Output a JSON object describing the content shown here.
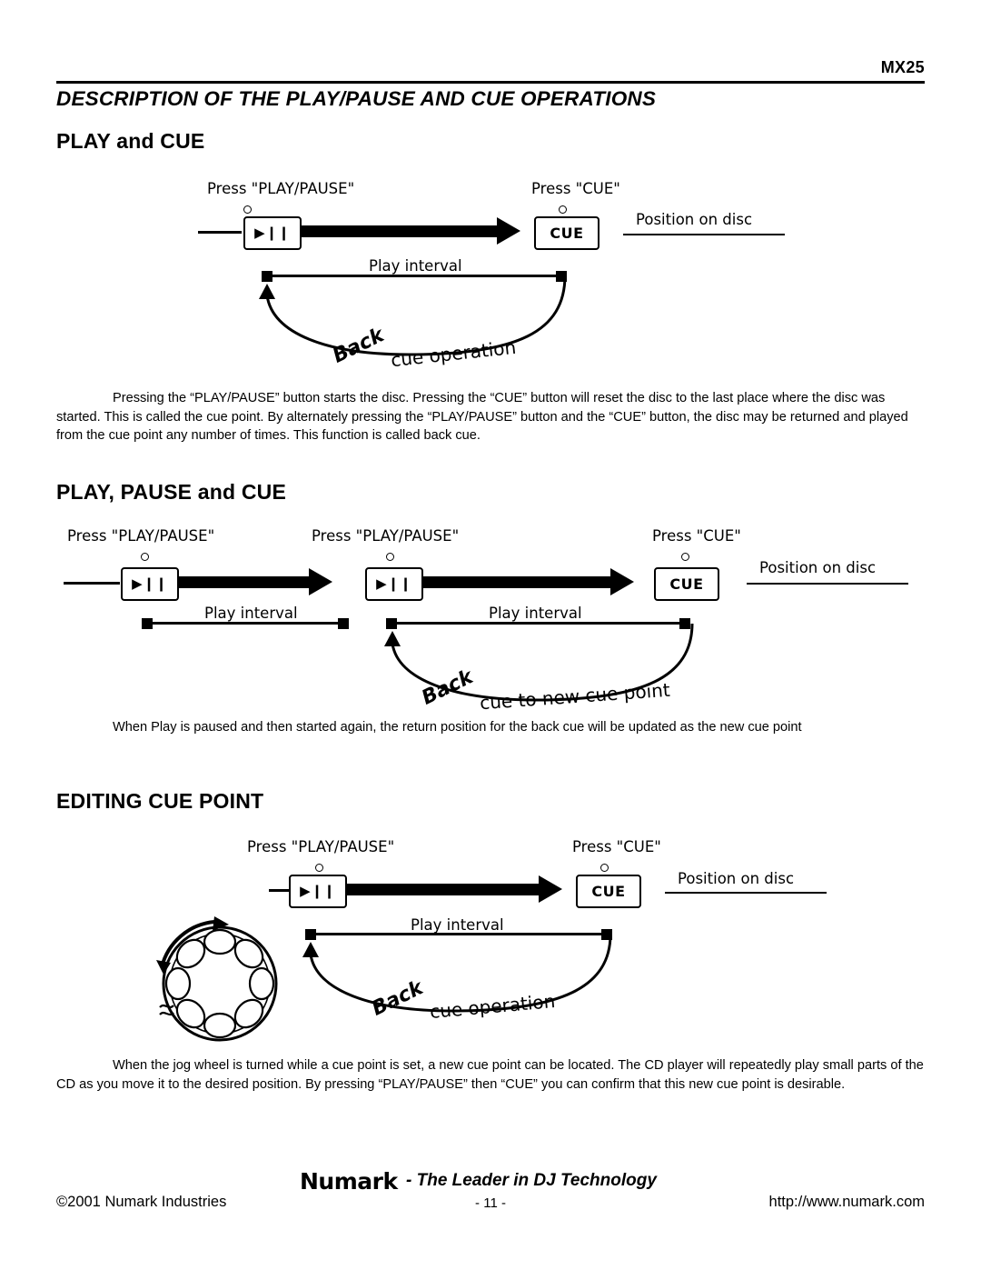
{
  "header": {
    "model": "MX25",
    "title": "DESCRIPTION OF THE PLAY/PAUSE AND CUE OPERATIONS"
  },
  "sections": [
    {
      "heading": "PLAY and CUE",
      "diagram": {
        "press_play_pause": "Press \"PLAY/PAUSE\"",
        "press_cue": "Press \"CUE\"",
        "position_on_disc": "Position on disc",
        "play_interval": "Play interval",
        "back_curve_bold": "Back",
        "back_curve_rest": "cue operation",
        "play_button_glyph": "▶❙❙",
        "cue_button_label": "CUE"
      },
      "paragraph": "Pressing the “PLAY/PAUSE” button starts the disc. Pressing the “CUE” button will reset the disc to the last place where the disc was started.   This is called the cue point.  By alternately pressing the “PLAY/PAUSE” button and the “CUE” button, the disc may be returned and played from the cue point any number of times.  This function is called back cue."
    },
    {
      "heading": "PLAY, PAUSE and CUE",
      "diagram": {
        "press_play_pause_1": "Press \"PLAY/PAUSE\"",
        "press_play_pause_2": "Press \"PLAY/PAUSE\"",
        "press_cue": "Press \"CUE\"",
        "position_on_disc": "Position on disc",
        "play_interval_1": "Play interval",
        "play_interval_2": "Play interval",
        "back_curve_bold": "Back",
        "back_curve_rest": "cue to new cue point",
        "play_button_glyph": "▶❙❙",
        "cue_button_label": "CUE"
      },
      "paragraph": "When Play is paused and then started again, the return position for the back cue will be updated as the new cue point"
    },
    {
      "heading": "EDITING CUE POINT",
      "diagram": {
        "press_play_pause": "Press \"PLAY/PAUSE\"",
        "press_cue": "Press \"CUE\"",
        "position_on_disc": "Position on disc",
        "play_interval": "Play interval",
        "back_curve_bold": "Back",
        "back_curve_rest": "cue operation",
        "play_button_glyph": "▶❙❙",
        "cue_button_label": "CUE",
        "jog_wheel_name": "jog-wheel"
      },
      "paragraph": "When the jog wheel is turned while a cue point is set, a new cue point can be located.   The CD player will repeatedly play small parts of the CD as you move it to the desired position.  By pressing “PLAY/PAUSE” then “CUE” you can confirm that this new cue point is desirable."
    }
  ],
  "footer": {
    "logo": "Numark",
    "tagline": "- The Leader in DJ Technology",
    "copyright": "©2001 Numark Industries",
    "page_number": "- 11 -",
    "website": "http://www.numark.com"
  }
}
